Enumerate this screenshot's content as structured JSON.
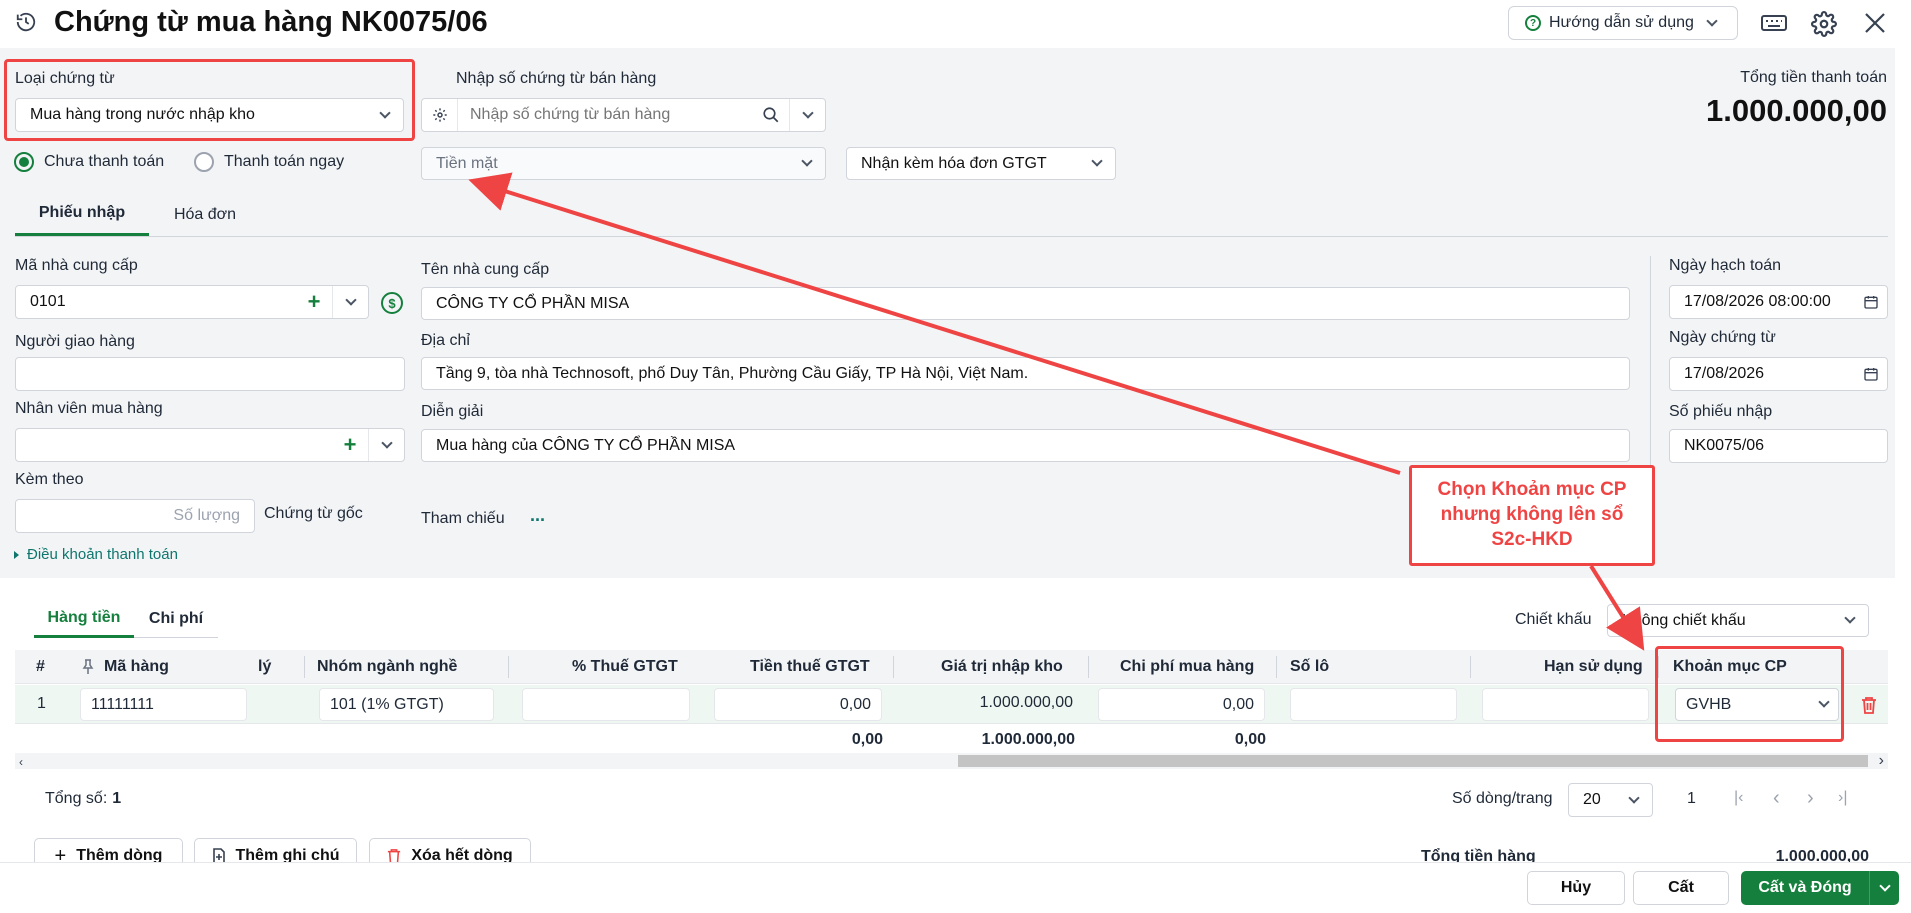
{
  "title": "Chứng từ mua hàng NK0075/06",
  "help_label": "Hướng dẫn sử dụng",
  "loai_chung_tu": {
    "label": "Loại chứng từ",
    "value": "Mua hàng trong nước nhập kho"
  },
  "nhap_so": {
    "label": "Nhập số chứng từ bán hàng",
    "placeholder": "Nhập số chứng từ bán hàng"
  },
  "total": {
    "label": "Tổng tiền thanh toán",
    "value": "1.000.000,00"
  },
  "payment": {
    "unpaid": "Chưa thanh toán",
    "paid_now": "Thanh toán ngay",
    "method": "Tiền mặt",
    "invoice": "Nhận kèm hóa đơn GTGT"
  },
  "tabs": {
    "phieu_nhap": "Phiếu nhập",
    "hoa_don": "Hóa đơn"
  },
  "form": {
    "ma_ncc_label": "Mã nhà cung cấp",
    "ma_ncc": "0101",
    "ten_ncc_label": "Tên nhà cung cấp",
    "ten_ncc": "CÔNG TY CỔ PHẦN MISA",
    "nguoi_giao_label": "Người giao hàng",
    "dia_chi_label": "Địa chỉ",
    "dia_chi": "Tầng 9, tòa nhà Technosoft, phố Duy Tân, Phường Cầu Giấy, TP Hà Nội, Việt Nam.",
    "nhan_vien_label": "Nhân viên mua hàng",
    "dien_giai_label": "Diễn giải",
    "dien_giai": "Mua hàng của CÔNG TY CỔ PHẦN MISA",
    "kem_theo_label": "Kèm theo",
    "so_luong_placeholder": "Số lượng",
    "chung_tu_goc": "Chứng từ gốc",
    "tham_chieu_label": "Tham chiếu",
    "tham_chieu_more": "...",
    "dieu_khoan": "Điều khoản thanh toán",
    "ngay_hach_toan_label": "Ngày hạch toán",
    "ngay_hach_toan": "17/08/2026 08:00:00",
    "ngay_chung_tu_label": "Ngày chứng từ",
    "ngay_chung_tu": "17/08/2026",
    "so_phieu_label": "Số phiếu nhập",
    "so_phieu": "NK0075/06"
  },
  "grid_tabs": {
    "hang_tien": "Hàng tiền",
    "chi_phi": "Chi phí"
  },
  "chiet_khau": {
    "label": "Chiết khấu",
    "value": "Không chiết khấu"
  },
  "table": {
    "headers": [
      "#",
      "Mã hàng",
      "lý",
      "Nhóm ngành nghề",
      "% Thuế GTGT",
      "Tiền thuế GTGT",
      "Giá trị nhập kho",
      "Chi phí mua hàng",
      "Số lô",
      "Hạn sử dụng",
      "Khoản mục CP"
    ],
    "row": {
      "no": "1",
      "ma_hang": "11111111",
      "nhom": "101 (1% GTGT)",
      "thue_pct": "",
      "tien_thue": "0,00",
      "gia_tri": "1.000.000,00",
      "chi_phi": "0,00",
      "so_lo": "",
      "han": "",
      "khoan_muc": "GVHB"
    },
    "totals": {
      "tien_thue": "0,00",
      "gia_tri": "1.000.000,00",
      "chi_phi": "0,00"
    }
  },
  "footer": {
    "tong_so_label": "Tổng số:",
    "tong_so": "1",
    "so_dong_label": "Số dòng/trang",
    "so_dong": "20",
    "page": "1",
    "them_dong": "Thêm dòng",
    "them_ghi_chu": "Thêm ghi chú",
    "xoa_het": "Xóa hết dòng",
    "tong_tien_hang_label": "Tổng tiền hàng",
    "tong_tien_hang": "1.000.000,00"
  },
  "actions": {
    "huy": "Hủy",
    "cat": "Cất",
    "cat_dong": "Cất và Đóng"
  },
  "callout": "Chọn Khoản mục CP nhưng không lên sổ S2c-HKD",
  "colors": {
    "accent": "#15803d",
    "annotation": "#ef4444",
    "header_bg": "#f3f4f6"
  }
}
